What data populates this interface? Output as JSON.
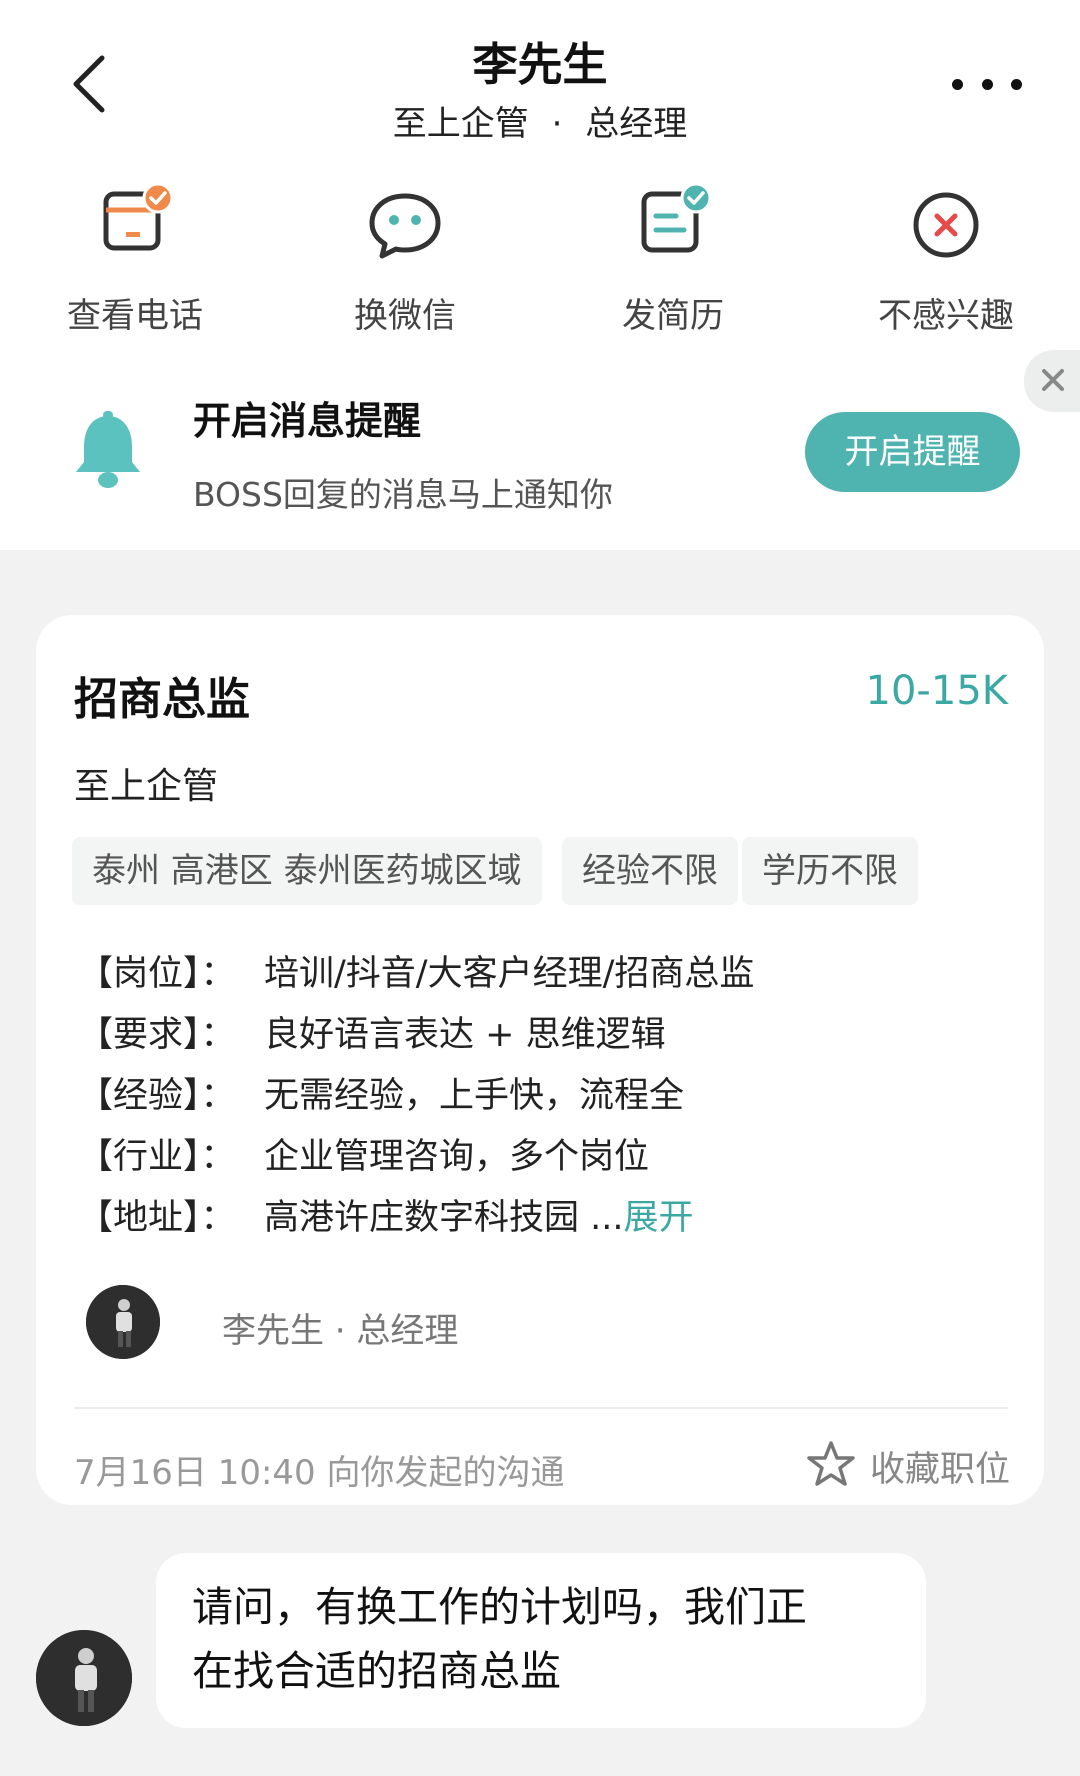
{
  "header": {
    "title": "李先生",
    "company": "至上企管",
    "separator": "·",
    "position": "总经理"
  },
  "actions": [
    {
      "label": "查看电话",
      "icon": "phone-card-icon"
    },
    {
      "label": "换微信",
      "icon": "wechat-chat-icon"
    },
    {
      "label": "发简历",
      "icon": "resume-send-icon"
    },
    {
      "label": "不感兴趣",
      "icon": "not-interested-icon"
    }
  ],
  "notification": {
    "title": "开启消息提醒",
    "description": "BOSS回复的消息马上通知你",
    "button_label": "开启提醒"
  },
  "job": {
    "title": "招商总监",
    "salary": "10-15K",
    "company": "至上企管",
    "tags": [
      "泰州 高港区 泰州医药城区域",
      "经验不限",
      "学历不限"
    ],
    "details": [
      {
        "key": "【岗位】：",
        "value": "培训/抖音/大客户经理/招商总监"
      },
      {
        "key": "【要求】：",
        "value": "良好语言表达 + 思维逻辑"
      },
      {
        "key": "【经验】：",
        "value": "无需经验，上手快，流程全"
      },
      {
        "key": "【行业】：",
        "value": "企业管理咨询，多个岗位"
      },
      {
        "key": "【地址】：",
        "value": "高港许庄数字科技园 ...",
        "more": "展开"
      }
    ],
    "recruiter": "李先生 · 总经理",
    "initiated": "7月16日 10:40 向你发起的沟通",
    "favorite_label": "收藏职位"
  },
  "message": {
    "line1": "请问，有换工作的计划吗，我们正",
    "line2": "在找合适的招商总监"
  },
  "colors": {
    "accent": "#4fb4b0",
    "accent_text": "#3ba8a4",
    "badge_orange": "#f08a4b",
    "bell": "#5cc2c0",
    "danger": "#e64a4a"
  }
}
